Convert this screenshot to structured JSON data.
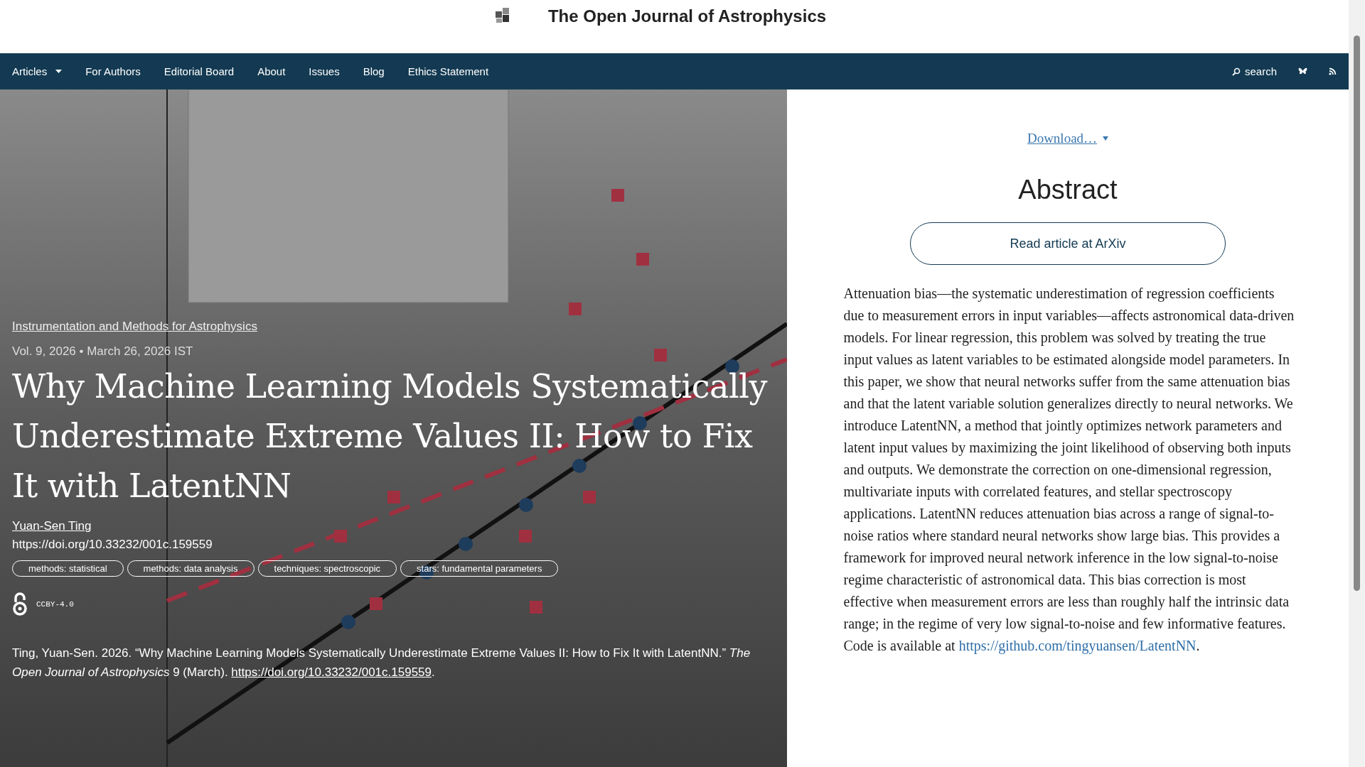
{
  "header": {
    "title": "The Open Journal of Astrophysics"
  },
  "nav": {
    "items": [
      {
        "label": "Articles",
        "dropdown": true
      },
      {
        "label": "For Authors",
        "dropdown": false
      },
      {
        "label": "Editorial Board",
        "dropdown": false
      },
      {
        "label": "About",
        "dropdown": false
      },
      {
        "label": "Issues",
        "dropdown": false
      },
      {
        "label": "Blog",
        "dropdown": false
      },
      {
        "label": "Ethics Statement",
        "dropdown": false
      }
    ],
    "search": "search"
  },
  "article": {
    "category": "Instrumentation and Methods for Astrophysics",
    "meta": "Vol. 9, 2026 • March 26, 2026 IST",
    "title": "Why Machine Learning Models Systematically Underestimate Extreme Values II: How to Fix It with LatentNN",
    "author": "Yuan-Sen Ting",
    "doi": "https://doi.org/10.33232/001c.159559",
    "tags": [
      "methods: statistical",
      "methods: data analysis",
      "techniques: spectroscopic",
      "stars: fundamental parameters"
    ],
    "license": "CCBY-4.0",
    "citation": {
      "text": "Ting, Yuan-Sen. 2026. “Why Machine Learning Models Systematically Underestimate Extreme Values II: How to Fix It with LatentNN.” *The Open Journal of Astrophysics* 9 (March).",
      "link": "https://doi.org/10.33232/001c.159559",
      "end": "."
    }
  },
  "side": {
    "download": "Download…",
    "heading": "Abstract",
    "arxiv_button": "Read article at ArXiv",
    "abstract": "Attenuation bias—the systematic underestimation of regression coefficients due to measurement errors in input variables—affects astronomical data-driven models. For linear regression, this problem was solved by treating the true input values as latent variables to be estimated alongside model parameters. In this paper, we show that neural networks suffer from the same attenuation bias and that the latent variable solution generalizes directly to neural networks. We introduce LatentNN, a method that jointly optimizes network parameters and latent input values by maximizing the joint likelihood of observing both inputs and outputs. We demonstrate the correction on one-dimensional regression, multivariate inputs with correlated features, and stellar spectroscopy applications. LatentNN reduces attenuation bias across a range of signal-to-noise ratios where standard neural networks show large bias. This provides a framework for improved neural network inference in the low signal-to-noise regime characteristic of astronomical data. This bias correction is most effective when measurement errors are less than roughly half the intrinsic data range; in the regime of very low signal-to-noise and few informative features. Code is available at",
    "abstract_link": "https://github.com/tingyuansen/LatentNN",
    "abstract_end": "."
  }
}
